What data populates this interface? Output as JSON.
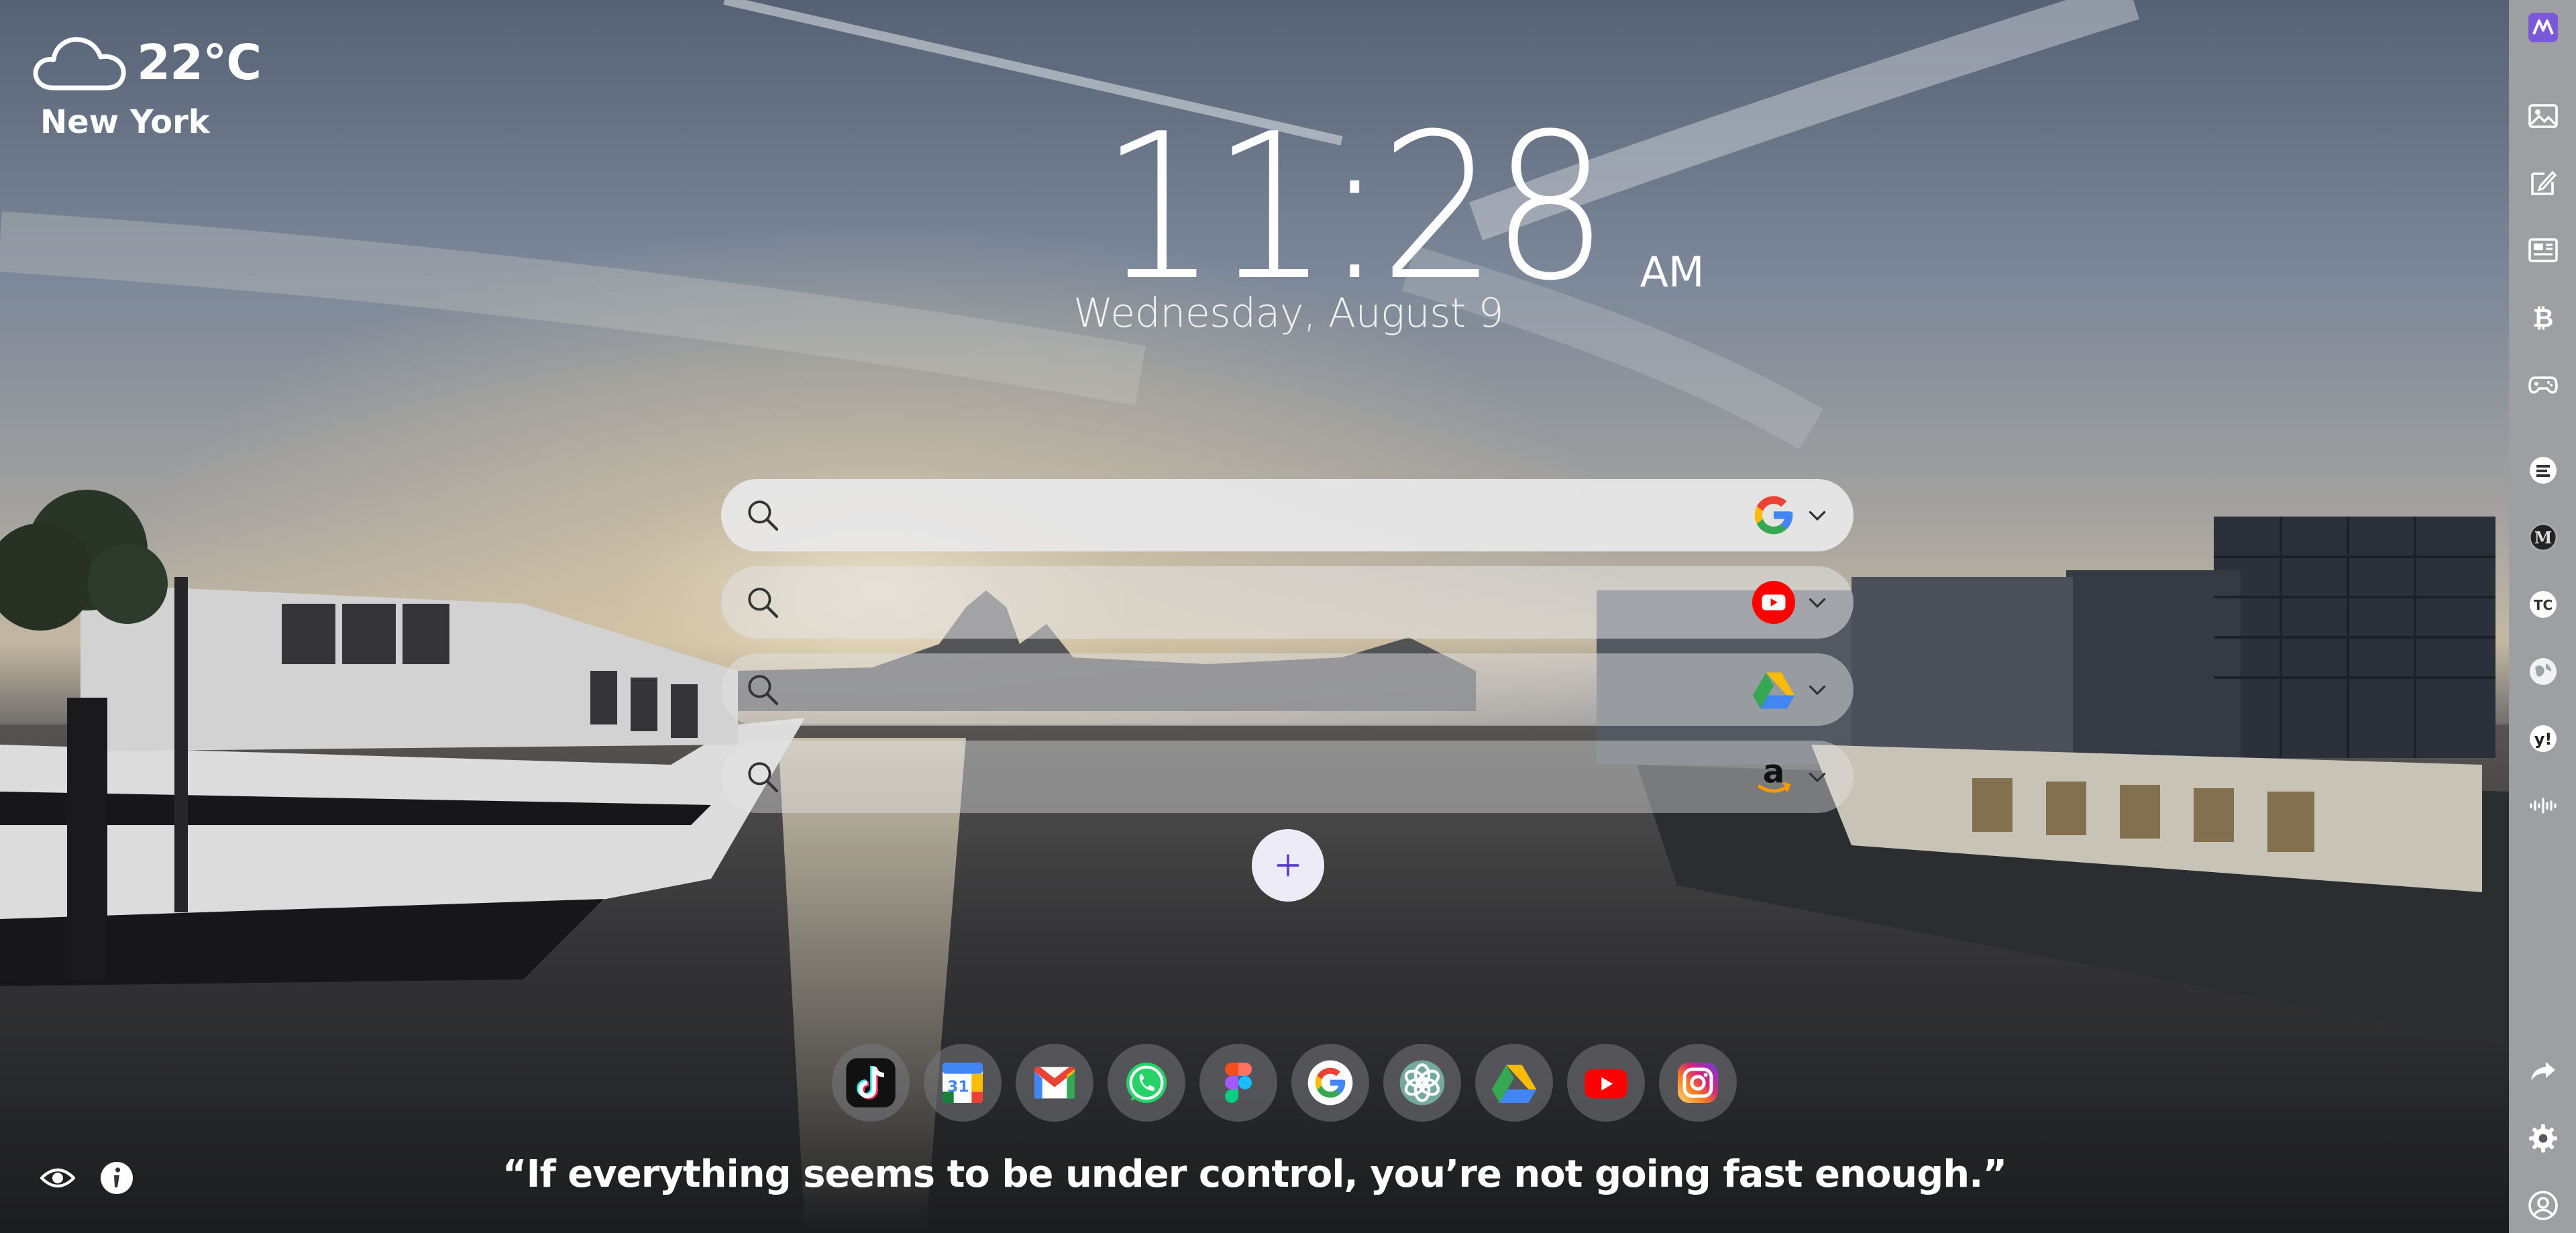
{
  "weather": {
    "temperature": "22°C",
    "city": "New York",
    "icon": "cloud-icon"
  },
  "clock": {
    "time": "11:28",
    "meridiem": "AM",
    "date": "Wednesday, August 9"
  },
  "searches": [
    {
      "engine": "Google",
      "icon": "google-icon",
      "placeholder": ""
    },
    {
      "engine": "YouTube",
      "icon": "youtube-icon",
      "placeholder": ""
    },
    {
      "engine": "Google Drive",
      "icon": "google-drive-icon",
      "placeholder": ""
    },
    {
      "engine": "Amazon",
      "icon": "amazon-icon",
      "placeholder": ""
    }
  ],
  "add_search_icon": "plus-icon",
  "dock": [
    {
      "name": "TikTok",
      "icon": "tiktok-icon"
    },
    {
      "name": "Google Calendar",
      "icon": "google-calendar-icon",
      "label": "31"
    },
    {
      "name": "Gmail",
      "icon": "gmail-icon"
    },
    {
      "name": "WhatsApp",
      "icon": "whatsapp-icon"
    },
    {
      "name": "Figma",
      "icon": "figma-icon"
    },
    {
      "name": "Google",
      "icon": "google-icon"
    },
    {
      "name": "ChatGPT",
      "icon": "chatgpt-icon"
    },
    {
      "name": "Google Drive",
      "icon": "google-drive-icon"
    },
    {
      "name": "YouTube",
      "icon": "youtube-icon"
    },
    {
      "name": "Instagram",
      "icon": "instagram-icon"
    }
  ],
  "quote": "“If everything seems to be under control, you’re not going fast enough.”",
  "rail": {
    "top": [
      "logo-icon",
      "image-icon",
      "edit-icon",
      "news-icon",
      "bitcoin-icon",
      "gamepad-icon"
    ],
    "sources": [
      "engadget-icon",
      "medium-icon",
      "techcrunch-icon",
      "globe-icon",
      "yahoo-icon",
      "audio-wave-icon"
    ],
    "bottom": [
      "share-icon",
      "settings-icon",
      "user-icon"
    ],
    "source_labels": {
      "techcrunch": "TC",
      "yahoo": "y!"
    }
  },
  "colors": {
    "accent": "#7b57d9",
    "google_blue": "#4285f4",
    "google_red": "#ea4335",
    "google_yellow": "#fbbc05",
    "google_green": "#34a853",
    "youtube_red": "#ff0000",
    "amazon_orange": "#ff9900",
    "whatsapp_green": "#25d366"
  }
}
